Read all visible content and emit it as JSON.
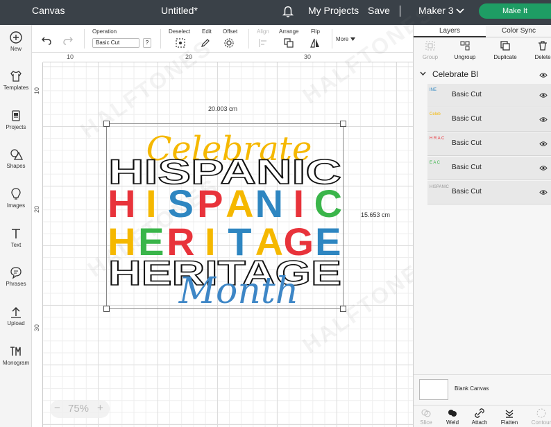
{
  "topbar": {
    "canvas_label": "Canvas",
    "doc_title": "Untitled*",
    "my_projects": "My Projects",
    "save": "Save",
    "machine": "Maker 3",
    "make_it": "Make It"
  },
  "leftbar": [
    {
      "label": "New",
      "icon": "plus-circle-icon"
    },
    {
      "label": "Templates",
      "icon": "shirt-icon"
    },
    {
      "label": "Projects",
      "icon": "projects-icon"
    },
    {
      "label": "Shapes",
      "icon": "shapes-icon"
    },
    {
      "label": "Images",
      "icon": "bulb-icon"
    },
    {
      "label": "Text",
      "icon": "text-t-icon"
    },
    {
      "label": "Phrases",
      "icon": "speech-bubble-icon"
    },
    {
      "label": "Upload",
      "icon": "upload-arrow-icon"
    },
    {
      "label": "Monogram",
      "icon": "monogram-icon"
    }
  ],
  "toolbar": {
    "operation_label": "Operation",
    "operation_value": "Basic Cut",
    "help": "?",
    "deselect": "Deselect",
    "edit": "Edit",
    "offset": "Offset",
    "align": "Align",
    "arrange": "Arrange",
    "flip": "Flip",
    "more": "More"
  },
  "rulers": {
    "top": [
      "10",
      "20",
      "30"
    ],
    "left": [
      "10",
      "20",
      "30"
    ]
  },
  "canvas": {
    "width_label": "20.003 cm",
    "height_label": "15.653 cm",
    "zoom": "75%",
    "zoom_minus": "−",
    "zoom_plus": "+"
  },
  "design": {
    "line1": "Celebrate",
    "line2": "HISPANIC",
    "line3_letters": [
      "H",
      "I",
      "S",
      "P",
      "A",
      "N",
      "I",
      "C"
    ],
    "line4_letters": [
      "H",
      "E",
      "R",
      "I",
      "T",
      "A",
      "G",
      "E"
    ],
    "line5": "HERITAGE",
    "line6": "Month",
    "colors": {
      "gold": "#f5b800",
      "red": "#e8333b",
      "blue": "#2e86c1",
      "green": "#3ab54a",
      "script_blue": "#3d86c6"
    },
    "line3_colors": [
      "#e8333b",
      "#f5b800",
      "#2e86c1",
      "#e8333b",
      "#f5b800",
      "#2e86c1",
      "#e8333b",
      "#3ab54a"
    ],
    "line4_colors": [
      "#f5b800",
      "#3ab54a",
      "#e8333b",
      "#f5b800",
      "#2e86c1",
      "#f5b800",
      "#e8333b",
      "#2e86c1"
    ]
  },
  "rpanel": {
    "tab_layers": "Layers",
    "tab_color_sync": "Color Sync",
    "actions": [
      "Group",
      "Ungroup",
      "Duplicate",
      "Delete"
    ],
    "group_name": "Celebrate Bl",
    "layers": [
      {
        "name": "Basic Cut",
        "thumb_color": "#2e86c1",
        "thumb_text": "INE"
      },
      {
        "name": "Basic Cut",
        "thumb_color": "#f5b800",
        "thumb_text": "Celeb"
      },
      {
        "name": "Basic Cut",
        "thumb_color": "#e8333b",
        "thumb_text": "H R A C"
      },
      {
        "name": "Basic Cut",
        "thumb_color": "#3ab54a",
        "thumb_text": "E A C"
      },
      {
        "name": "Basic Cut",
        "thumb_color": "#999999",
        "thumb_text": "HISPANIC"
      }
    ],
    "blank_canvas": "Blank Canvas",
    "bottom_actions": [
      "Slice",
      "Weld",
      "Attach",
      "Flatten",
      "Contour"
    ]
  },
  "watermark": "HALFTONES"
}
